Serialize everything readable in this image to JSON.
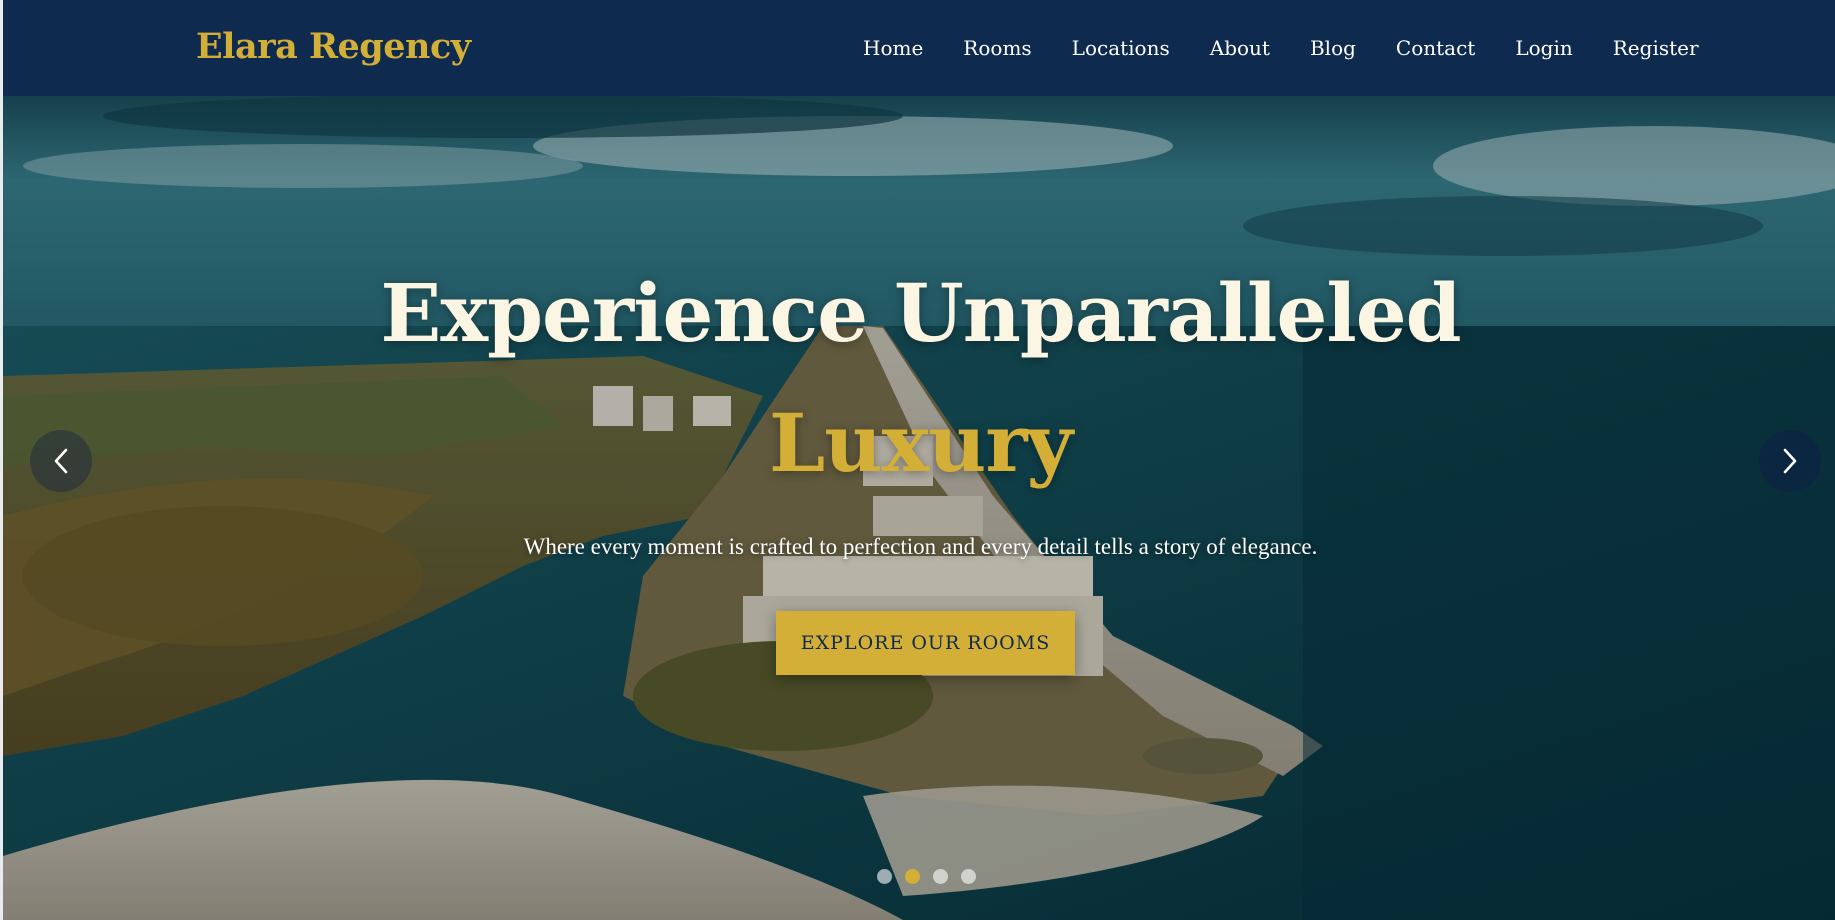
{
  "brand": {
    "name": "Elara Regency"
  },
  "nav": {
    "items": [
      {
        "label": "Home"
      },
      {
        "label": "Rooms"
      },
      {
        "label": "Locations"
      },
      {
        "label": "About"
      },
      {
        "label": "Blog"
      },
      {
        "label": "Contact"
      },
      {
        "label": "Login"
      },
      {
        "label": "Register"
      }
    ]
  },
  "hero": {
    "headline_line1": "Experience Unparalleled",
    "headline_line2": "Luxury",
    "subtitle": "Where every moment is crafted to perfection and every detail tells a story of elegance.",
    "cta_label": "EXPLORE OUR ROOMS",
    "background_image": "aerial-coastal-resort-photo",
    "prev_icon": "chevron-left-icon",
    "next_icon": "chevron-right-icon",
    "slides_total": 4,
    "active_slide": 2
  },
  "colors": {
    "navbar_bg": "#0f2a4f",
    "accent_gold": "#d4af37",
    "headline_cream": "#fbf6e4",
    "text_white": "#ffffff"
  }
}
